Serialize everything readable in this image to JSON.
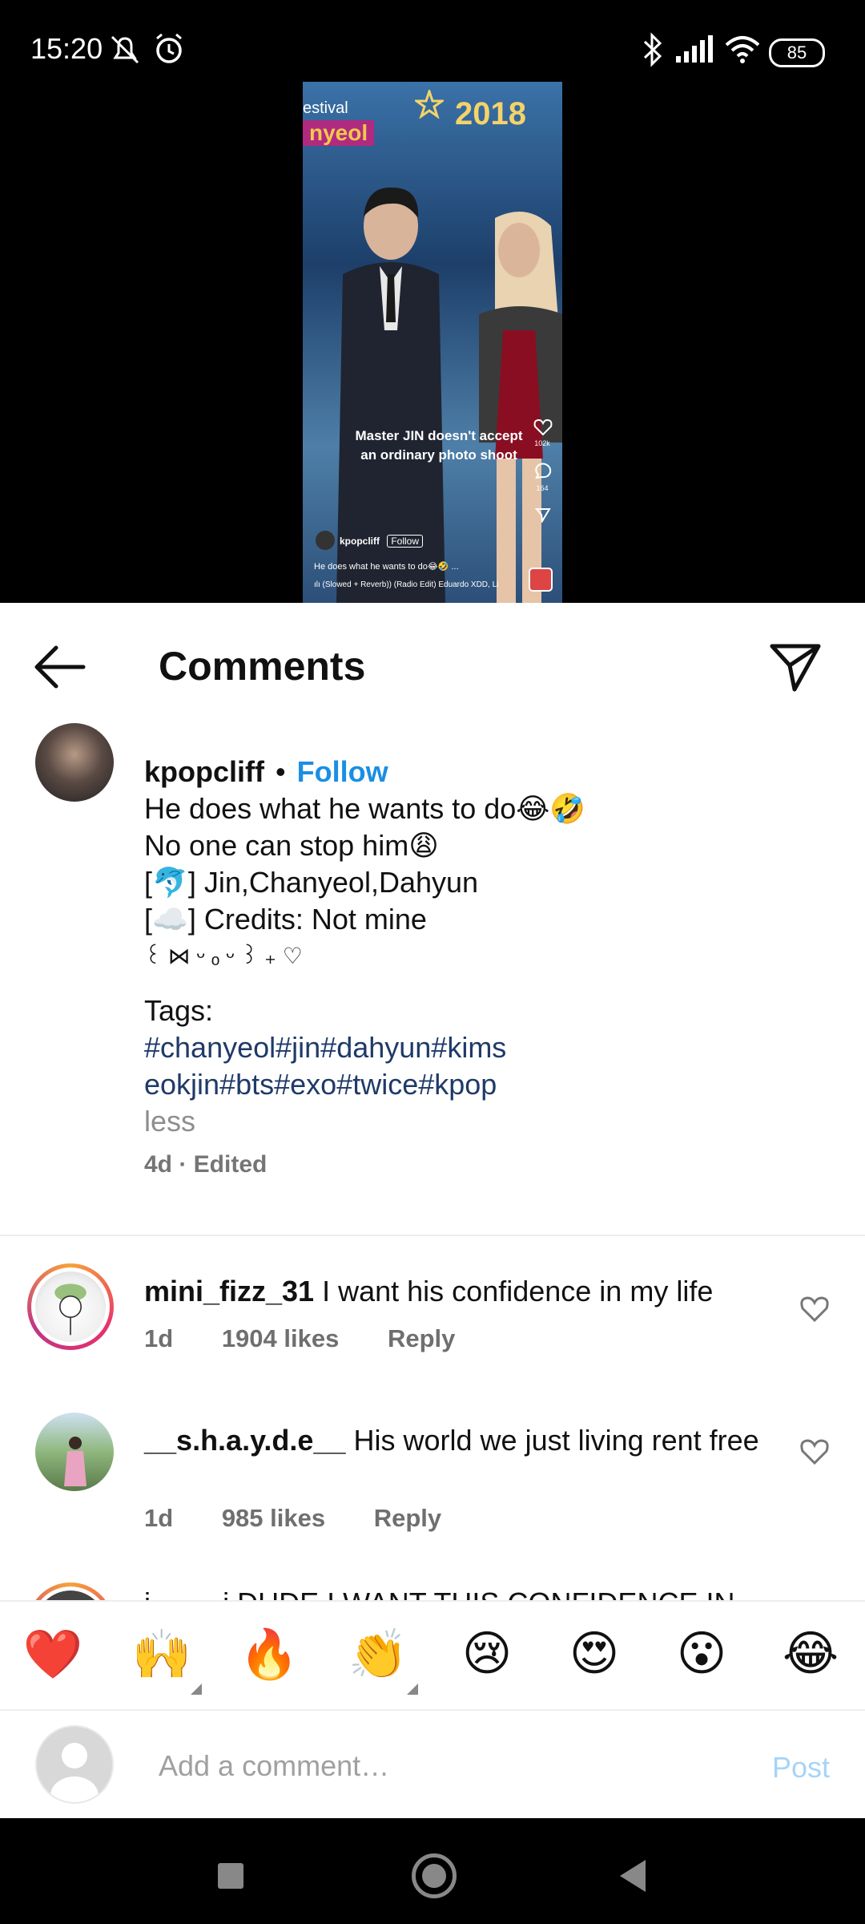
{
  "status": {
    "time": "15:20",
    "battery": "85"
  },
  "video": {
    "year": "2018",
    "festival": "estival",
    "name_fragment": "nyeol",
    "overlay_text": [
      "Master JIN doesn't accept",
      "an ordinary photo shoot"
    ],
    "username": "kpopcliff",
    "follow": "Follow",
    "caption": "He does what he wants to do😂🤣 ...",
    "music": "ılı (Slowed + Reverb)) (Radio Edit)  Eduardo XDD, Li",
    "likes": "102k",
    "comments": "164"
  },
  "header": {
    "title": "Comments"
  },
  "caption": {
    "username": "kpopcliff",
    "follow_label": "Follow",
    "lines": [
      "He does what he wants to do😂🤣",
      "No one can stop him😩",
      "[🐬] Jin,Chanyeol,Dahyun",
      "[☁️] Credits: Not mine",
      "꒰ ⋈ ᵕ ₒ ᵕ ꒱ ₊ ♡"
    ],
    "tags_label": "Tags:",
    "tags_line1": "#chanyeol#jin#dahyun#kims",
    "tags_line2": "eokjin#bts#exo#twice#kpop",
    "less": "less",
    "meta": "4d · Edited"
  },
  "comments": [
    {
      "username": "mini_fizz_31",
      "text": "I want his confidence in my life",
      "age": "1d",
      "likes": "1904 likes",
      "reply": "Reply"
    },
    {
      "username": "__s.h.a.y.d.e__",
      "text": "His world we just living rent free",
      "age": "1d",
      "likes": "985 likes",
      "reply": "Reply"
    }
  ],
  "partial_comment": "i____ j DUDE I WANT THIS CONFIDENCE IN",
  "emoji_bar": [
    "❤️",
    "🙌",
    "🔥",
    "👏",
    "😢",
    "😍",
    "😮",
    "😂"
  ],
  "compose": {
    "placeholder": "Add a comment…",
    "post": "Post"
  }
}
